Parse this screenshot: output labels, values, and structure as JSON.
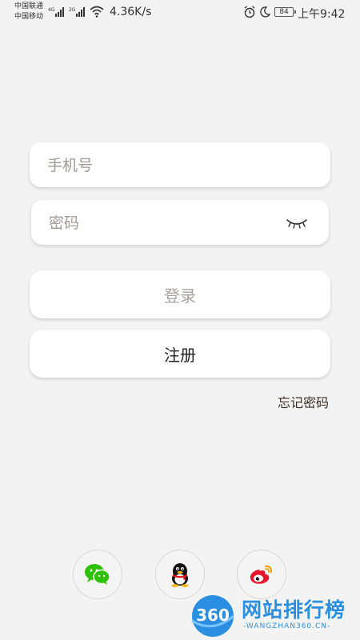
{
  "status_bar": {
    "carrier_1": "中国联通",
    "carrier_2": "中国移动",
    "net_1": "4G",
    "net_2": "2G",
    "speed": "4.36K/s",
    "battery": "84",
    "time": "上午9:42",
    "icons": [
      "signal-icon",
      "wifi-icon",
      "alarm-icon",
      "moon-icon",
      "battery-icon"
    ]
  },
  "login_form": {
    "phone_placeholder": "手机号",
    "phone_value": "",
    "password_placeholder": "密码",
    "password_value": "",
    "password_toggle_icon": "eye-closed-icon",
    "login_label": "登录",
    "register_label": "注册",
    "forgot_label": "忘记密码"
  },
  "social_login": {
    "items": [
      {
        "name": "wechat",
        "icon": "wechat-icon",
        "color": "#2dc100"
      },
      {
        "name": "qq",
        "icon": "qq-icon",
        "color": "#000000"
      },
      {
        "name": "weibo",
        "icon": "weibo-icon",
        "color": "#e6162d"
      }
    ]
  },
  "watermark": {
    "logo_text": "360",
    "title": "网站排行榜",
    "subtitle": "-WANGZHAN360.CN-",
    "color": "#2a8fe0"
  }
}
